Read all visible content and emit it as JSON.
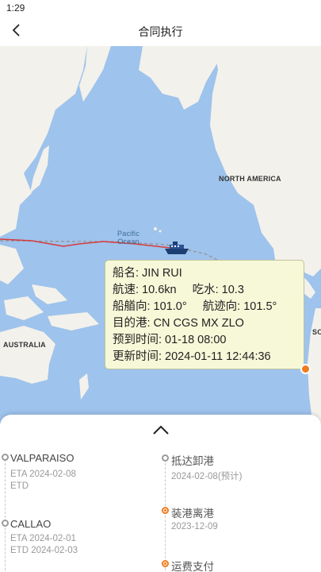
{
  "status_bar": {
    "time": "1:29"
  },
  "header": {
    "title": "合同执行",
    "back_icon": "chevron-left-icon"
  },
  "map": {
    "labels": {
      "north_america": "NORTH AMERICA",
      "pacific_line1": "Pacific",
      "pacific_line2": "Ocean",
      "australia": "AUSTRALIA",
      "south_partial": "SO"
    },
    "colors": {
      "water": "#9ec3ec",
      "land": "#f3f1ec",
      "route": "#d63a3a",
      "destination": "#f07a1c"
    }
  },
  "vessel_info": {
    "ship_name": "船名: JIN RUI",
    "speed": "航速: 10.6kn",
    "draft": "吃水: 10.3",
    "heading": "船艏向: 101.0°",
    "course": "航迹向: 101.5°",
    "destination": "目的港: CN CGS MX ZLO",
    "eta": "预到时间: 01-18 08:00",
    "updated": "更新时间: 2024-01-11 12:44:36"
  },
  "ports": [
    {
      "name": "VALPARAISO",
      "eta": "ETA 2024-02-08",
      "etd": "ETD"
    },
    {
      "name": "CALLAO",
      "eta": "ETA 2024-02-01",
      "etd": "ETD 2024-02-03"
    }
  ],
  "steps": [
    {
      "name": "抵达卸港",
      "date": "2024-02-08(预计)",
      "state": "pending"
    },
    {
      "name": "装港离港",
      "date": "2023-12-09",
      "state": "done"
    },
    {
      "name": "运费支付",
      "date": "",
      "state": "done"
    }
  ]
}
